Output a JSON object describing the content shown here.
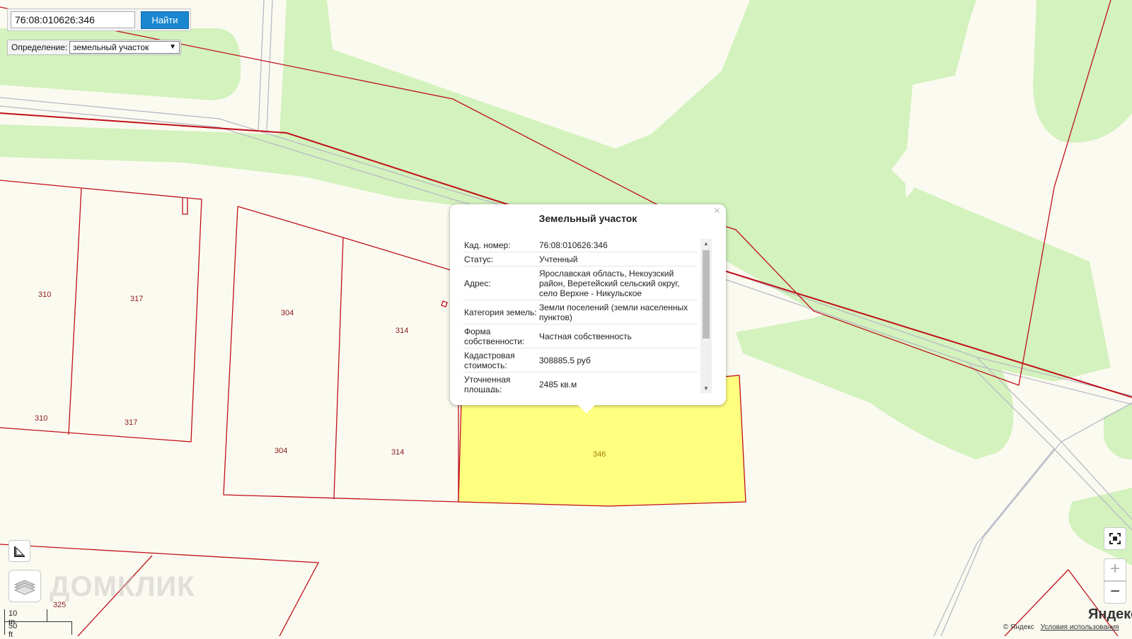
{
  "search": {
    "value": "76:08:010626:346",
    "button_label": "Найти"
  },
  "definition": {
    "label": "Определение:",
    "selected": "земельный участок"
  },
  "plots": [
    {
      "label": "310"
    },
    {
      "label": "317"
    },
    {
      "label": "304"
    },
    {
      "label": "314"
    },
    {
      "label": "310"
    },
    {
      "label": "317"
    },
    {
      "label": "304"
    },
    {
      "label": "314"
    },
    {
      "label": "346"
    },
    {
      "label": "325"
    }
  ],
  "popup": {
    "title": "Земельный участок",
    "rows": [
      {
        "key": "Кад. номер:",
        "value": "76:08:010626:346"
      },
      {
        "key": "Статус:",
        "value": "Учтенный"
      },
      {
        "key": "Адрес:",
        "value": "Ярославская область, Некоузский район, Веретейский сельский округ, село Верхне - Никульское"
      },
      {
        "key": "Категория земель:",
        "value": "Земли поселений (земли населенных пунктов)"
      },
      {
        "key": "Форма собственности:",
        "value": "Частная собственность"
      },
      {
        "key": "Кадастровая стоимость:",
        "value": "308885.5 руб"
      },
      {
        "key": "Уточненная площадь:",
        "value": "2485 кв.м"
      }
    ]
  },
  "scale": {
    "metric": "10 m",
    "imperial": "50 ft"
  },
  "watermark": "ДОМКЛИК",
  "map_provider": {
    "logo": "Яндекс",
    "copyright": "© Яндекс",
    "terms": "Условия использования"
  },
  "colors": {
    "selected_plot": "#ffff80",
    "boundary": "#c0101a",
    "green": "#d3f2bd",
    "background": "#fbfaf0"
  }
}
